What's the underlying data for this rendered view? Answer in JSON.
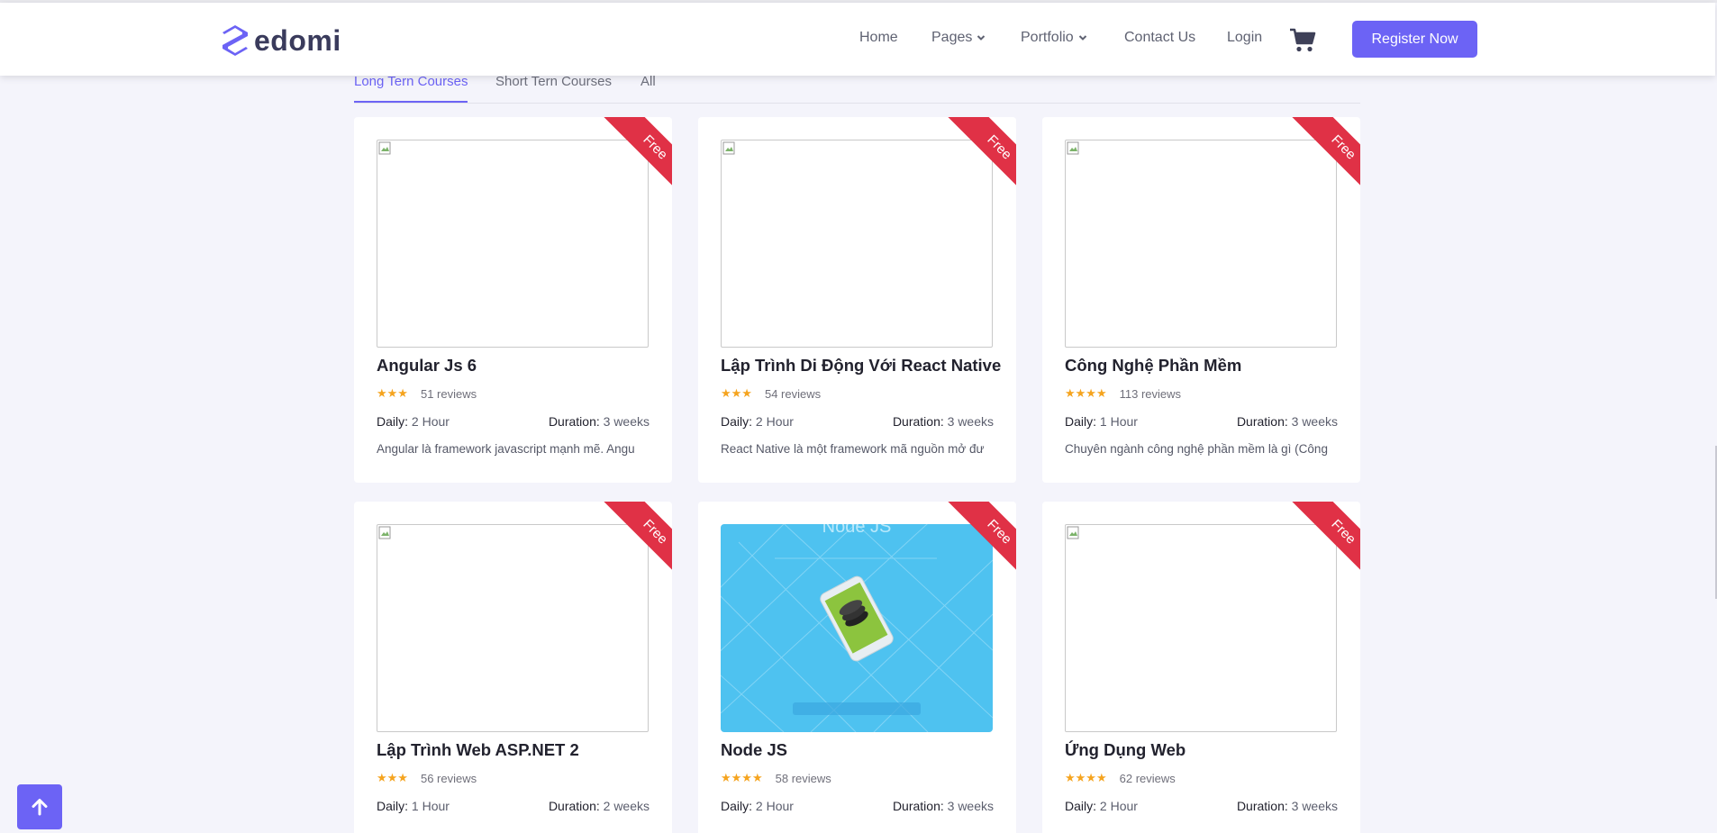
{
  "brand": {
    "name": "edomi",
    "accent": "#6c63f5"
  },
  "nav": {
    "items": [
      {
        "label": "Home",
        "dropdown": false
      },
      {
        "label": "Pages",
        "dropdown": true
      },
      {
        "label": "Portfolio",
        "dropdown": true
      },
      {
        "label": "Contact Us",
        "dropdown": false
      },
      {
        "label": "Login",
        "dropdown": false
      }
    ],
    "cart_icon": "shopping-cart-icon",
    "register_label": "Register Now"
  },
  "tabs": [
    {
      "label": "Long Tern Courses",
      "active": true
    },
    {
      "label": "Short Tern Courses",
      "active": false
    },
    {
      "label": "All",
      "active": false
    }
  ],
  "labels": {
    "daily": "Daily:",
    "duration": "Duration:",
    "ribbon": "Free"
  },
  "courses": [
    {
      "title": "Angular Js 6",
      "stars": "★★★",
      "rating": 3,
      "reviews": "51 reviews",
      "daily": "2 Hour",
      "duration": "3 weeks",
      "desc": "Angular là framework javascript mạnh mẽ. Angu",
      "ribbon": "Free"
    },
    {
      "title": "Lập Trình Di Động Với React Native",
      "stars": "★★★",
      "rating": 3,
      "reviews": "54 reviews",
      "daily": "2 Hour",
      "duration": "3 weeks",
      "desc": "React Native là một framework mã nguồn mở đư",
      "ribbon": "Free"
    },
    {
      "title": "Công Nghệ Phần Mềm",
      "stars": "★★★★",
      "rating": 4,
      "reviews": "113 reviews",
      "daily": "1 Hour",
      "duration": "3 weeks",
      "desc": "Chuyên ngành công nghệ phần mềm là gì (Công",
      "ribbon": "Free"
    },
    {
      "title": "Lập Trình Web ASP.NET 2",
      "stars": "★★★",
      "rating": 3,
      "reviews": "56 reviews",
      "daily": "1 Hour",
      "duration": "2 weeks",
      "desc": "",
      "ribbon": "Free"
    },
    {
      "title": "Node JS",
      "stars": "★★★★",
      "rating": 4,
      "reviews": "58 reviews",
      "daily": "2 Hour",
      "duration": "3 weeks",
      "desc": "",
      "ribbon": "Free",
      "image_text": "Node JS"
    },
    {
      "title": "Ứng Dụng Web",
      "stars": "★★★★",
      "rating": 4,
      "reviews": "62 reviews",
      "daily": "2 Hour",
      "duration": "3 weeks",
      "desc": "",
      "ribbon": "Free"
    }
  ],
  "back_to_top_icon": "arrow-up-icon"
}
